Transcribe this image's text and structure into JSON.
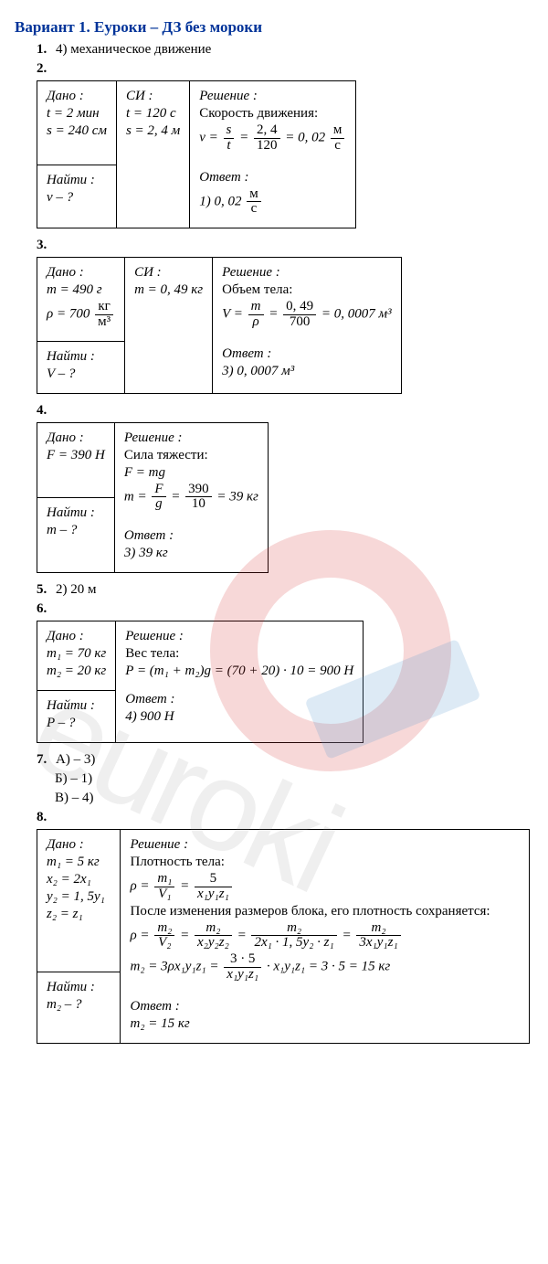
{
  "title": "Вариант 1. Еуроки – ДЗ без мороки",
  "watermark": "euroki",
  "q1": {
    "num": "1.",
    "text": "4) механическое движение"
  },
  "q2": {
    "num": "2.",
    "given_h": "Дано :",
    "g1": "t = 2 мин",
    "g2": "s = 240 см",
    "find_h": "Найти :",
    "find": "v – ?",
    "si_h": "СИ :",
    "si1": "t = 120 с",
    "si2": "s = 2, 4 м",
    "sol_h": "Решение :",
    "sol_t": "Скорость движения:",
    "eq_lhs": "v =",
    "f1n": "s",
    "f1d": "t",
    "f2n": "2, 4",
    "f2d": "120",
    "eq_r": "= 0, 02",
    "un_n": "м",
    "un_d": "с",
    "ans_h": "Ответ :",
    "ans": "1) 0, 02"
  },
  "q3": {
    "num": "3.",
    "given_h": "Дано :",
    "g1": "m = 490 г",
    "rho_l": "ρ = 700",
    "rho_n": "кг",
    "rho_d": "м³",
    "find_h": "Найти :",
    "find": "V – ?",
    "si_h": "СИ :",
    "si1": "m = 0, 49 кг",
    "sol_h": "Решение :",
    "sol_t": "Объем тела:",
    "eq_lhs": "V =",
    "f1n": "m",
    "f1d": "ρ",
    "f2n": "0, 49",
    "f2d": "700",
    "eq_r": "= 0, 0007 м³",
    "ans_h": "Ответ :",
    "ans": "3) 0, 0007 м³"
  },
  "q4": {
    "num": "4.",
    "given_h": "Дано :",
    "g1": "F = 390 Н",
    "find_h": "Найти :",
    "find": "m – ?",
    "sol_h": "Решение :",
    "sol_t": "Сила тяжести:",
    "eq1": "F = mg",
    "eq_lhs": "m =",
    "f1n": "F",
    "f1d": "g",
    "f2n": "390",
    "f2d": "10",
    "eq_r": "= 39 кг",
    "ans_h": "Ответ :",
    "ans": "3) 39 кг"
  },
  "q5": {
    "num": "5.",
    "text": "2) 20 м"
  },
  "q6": {
    "num": "6.",
    "given_h": "Дано :",
    "g1": "m₁ = 70 кг",
    "g2": "m₂ = 20 кг",
    "find_h": "Найти :",
    "find": "P – ?",
    "sol_h": "Решение :",
    "sol_t": "Вес тела:",
    "eq": "P = (m₁ + m₂)g = (70 + 20) · 10 = 900 Н",
    "ans_h": "Ответ :",
    "ans": "4) 900 Н"
  },
  "q7": {
    "num": "7.",
    "a": "А) – 3)",
    "b": "Б) – 1)",
    "c": "В) – 4)"
  },
  "q8": {
    "num": "8.",
    "given_h": "Дано :",
    "g1": "m₁ = 5 кг",
    "g2": "x₂ = 2x₁",
    "g3": "y₂ = 1, 5y₁",
    "g4": "z₂ = z₁",
    "find_h": "Найти :",
    "find": "m₂ – ?",
    "sol_h": "Решение :",
    "sol_t1": "Плотность тела:",
    "r1_l": "ρ =",
    "r1_f1n": "m₁",
    "r1_f1d": "V₁",
    "r1_f2n": "5",
    "r1_f2d": "x₁y₁z₁",
    "sol_t2": "После изменения размеров блока, его плотность сохраняется:",
    "r2_l": "ρ =",
    "r2_f1n": "m₂",
    "r2_f1d": "V₂",
    "r2_f2n": "m₂",
    "r2_f2d": "x₂y₂z₂",
    "r2_f3n": "m₂",
    "r2_f3d": "2x₁ · 1, 5y₂ · z₁",
    "r2_f4n": "m₂",
    "r2_f4d": "3x₁y₁z₁",
    "r3_l": "m₂ = 3ρx₁y₁z₁ =",
    "r3_fn": "3 · 5",
    "r3_fd": "x₁y₁z₁",
    "r3_r": "· x₁y₁z₁ = 3 · 5 = 15 кг",
    "ans_h": "Ответ :",
    "ans": "m₂ = 15 кг"
  }
}
